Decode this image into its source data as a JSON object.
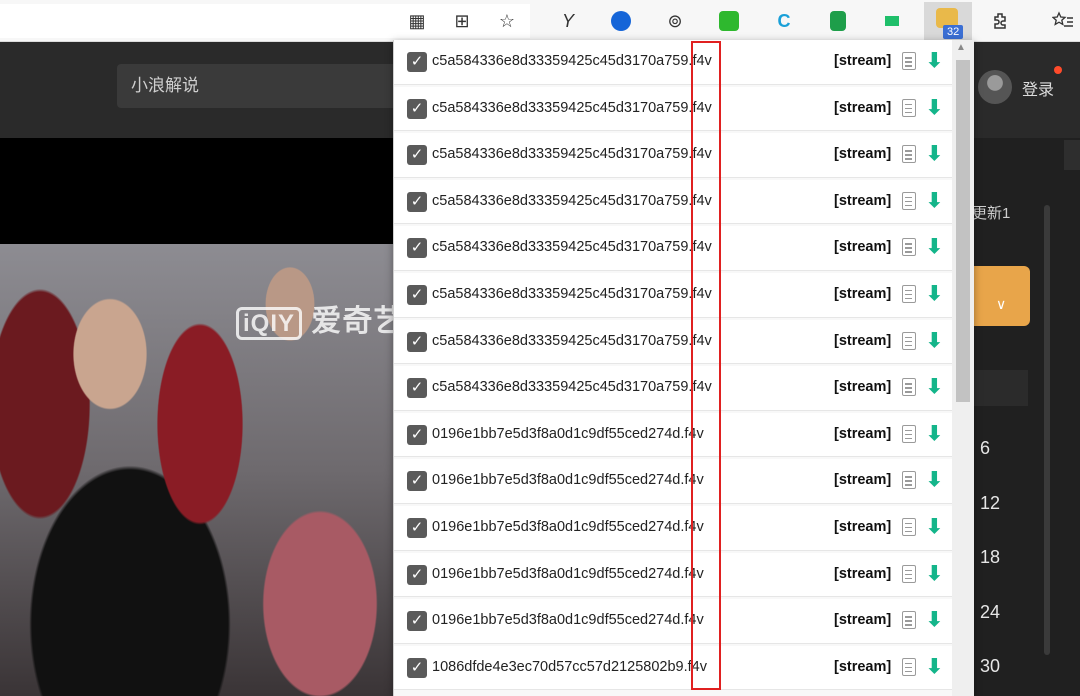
{
  "browser": {
    "extensions": [
      {
        "name": "apps-icon",
        "glyph": "▦"
      },
      {
        "name": "split-view-icon",
        "glyph": "⊞"
      },
      {
        "name": "favorite-add-icon",
        "glyph": "☆"
      },
      {
        "name": "extension-y-icon",
        "glyph": "Y"
      },
      {
        "name": "extension-blue-circle-icon",
        "glyph": ""
      },
      {
        "name": "extension-link-icon",
        "glyph": "⊚"
      },
      {
        "name": "extension-green-chat-icon",
        "glyph": ""
      },
      {
        "name": "extension-c-icon",
        "glyph": "C"
      },
      {
        "name": "extension-green-sheet-icon",
        "glyph": ""
      },
      {
        "name": "extension-green-flag-icon",
        "glyph": ""
      }
    ],
    "active_extension_badge": "32",
    "puzzle_icon": "extensions-icon",
    "favorites_icon": "favorites-list-icon"
  },
  "page": {
    "search_text": "小浪解说",
    "login_label": "登录",
    "video_watermark_box": "iQIY",
    "video_watermark_text": "爱奇艺",
    "right_update_text": "更新1",
    "right_orange_glyph": "∨",
    "right_numbers": [
      "6",
      "12",
      "18",
      "24",
      "30"
    ]
  },
  "popup": {
    "rows": [
      {
        "file": "c5a584336e8d33359425c45d3170a759.f4v",
        "tag": "[stream]"
      },
      {
        "file": "c5a584336e8d33359425c45d3170a759.f4v",
        "tag": "[stream]"
      },
      {
        "file": "c5a584336e8d33359425c45d3170a759.f4v",
        "tag": "[stream]"
      },
      {
        "file": "c5a584336e8d33359425c45d3170a759.f4v",
        "tag": "[stream]"
      },
      {
        "file": "c5a584336e8d33359425c45d3170a759.f4v",
        "tag": "[stream]"
      },
      {
        "file": "c5a584336e8d33359425c45d3170a759.f4v",
        "tag": "[stream]"
      },
      {
        "file": "c5a584336e8d33359425c45d3170a759.f4v",
        "tag": "[stream]"
      },
      {
        "file": "c5a584336e8d33359425c45d3170a759.f4v",
        "tag": "[stream]"
      },
      {
        "file": "0196e1bb7e5d3f8a0d1c9df55ced274d.f4v",
        "tag": "[stream]"
      },
      {
        "file": "0196e1bb7e5d3f8a0d1c9df55ced274d.f4v",
        "tag": "[stream]"
      },
      {
        "file": "0196e1bb7e5d3f8a0d1c9df55ced274d.f4v",
        "tag": "[stream]"
      },
      {
        "file": "0196e1bb7e5d3f8a0d1c9df55ced274d.f4v",
        "tag": "[stream]"
      },
      {
        "file": "0196e1bb7e5d3f8a0d1c9df55ced274d.f4v",
        "tag": "[stream]"
      },
      {
        "file": "1086dfde4e3ec70d57cc57d2125802b9.f4v",
        "tag": "[stream]"
      }
    ],
    "checkbox_glyph": "✓",
    "download_glyph": "⬇"
  },
  "colors": {
    "accent_green": "#14b58a",
    "highlight_red": "#e02020",
    "badge_blue": "#3b6fd4",
    "orange": "#e8a54a"
  }
}
